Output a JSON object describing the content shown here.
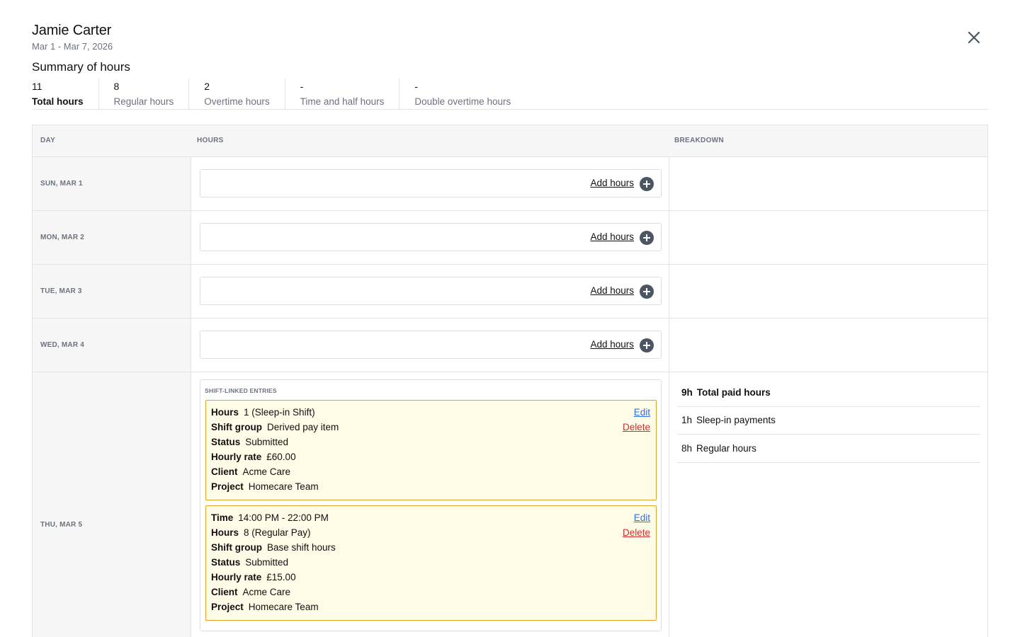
{
  "header": {
    "name": "Jamie Carter",
    "date_range": "Mar 1 - Mar 7, 2026",
    "close_icon": "close-icon"
  },
  "summary": {
    "title": "Summary of hours",
    "stats": [
      {
        "value": "11",
        "label": "Total hours"
      },
      {
        "value": "8",
        "label": "Regular hours"
      },
      {
        "value": "2",
        "label": "Overtime hours"
      },
      {
        "value": "-",
        "label": "Time and half hours"
      },
      {
        "value": "-",
        "label": "Double overtime hours"
      }
    ]
  },
  "table": {
    "headers": {
      "day": "DAY",
      "hours": "HOURS",
      "breakdown": "BREAKDOWN"
    },
    "add_hours_label": "Add hours",
    "add_icon": "plus-circle-icon",
    "days": [
      {
        "label": "SUN, MAR 1"
      },
      {
        "label": "MON, MAR 2"
      },
      {
        "label": "TUE, MAR 3"
      },
      {
        "label": "WED, MAR 4"
      },
      {
        "label": "THU, MAR 5",
        "shift_section_title": "SHIFT-LINKED ENTRIES",
        "edit_label": "Edit",
        "delete_label": "Delete",
        "entries": [
          {
            "hours": {
              "label": "Hours",
              "value": "1 (Sleep-in Shift)"
            },
            "shift_group": {
              "label": "Shift group",
              "value": "Derived pay item"
            },
            "status": {
              "label": "Status",
              "value": "Submitted"
            },
            "hourly_rate": {
              "label": "Hourly rate",
              "value": "£60.00"
            },
            "client": {
              "label": "Client",
              "value": "Acme Care"
            },
            "project": {
              "label": "Project",
              "value": "Homecare Team"
            }
          },
          {
            "time": {
              "label": "Time",
              "value": "14:00 PM - 22:00 PM"
            },
            "hours": {
              "label": "Hours",
              "value": "8 (Regular Pay)"
            },
            "shift_group": {
              "label": "Shift group",
              "value": "Base shift hours"
            },
            "status": {
              "label": "Status",
              "value": "Submitted"
            },
            "hourly_rate": {
              "label": "Hourly rate",
              "value": "£15.00"
            },
            "client": {
              "label": "Client",
              "value": "Acme Care"
            },
            "project": {
              "label": "Project",
              "value": "Homecare Team"
            }
          }
        ],
        "breakdown": [
          {
            "hours": "9h",
            "label": "Total paid hours"
          },
          {
            "hours": "1h",
            "label": "Sleep-in payments"
          },
          {
            "hours": "8h",
            "label": "Regular hours"
          }
        ]
      }
    ]
  },
  "colors": {
    "entry_background": "#fefbe7",
    "entry_border": "#e0a526",
    "edit_link": "#2f6fdf",
    "delete_link": "#d12d2d",
    "add_icon": "#4b5563"
  }
}
